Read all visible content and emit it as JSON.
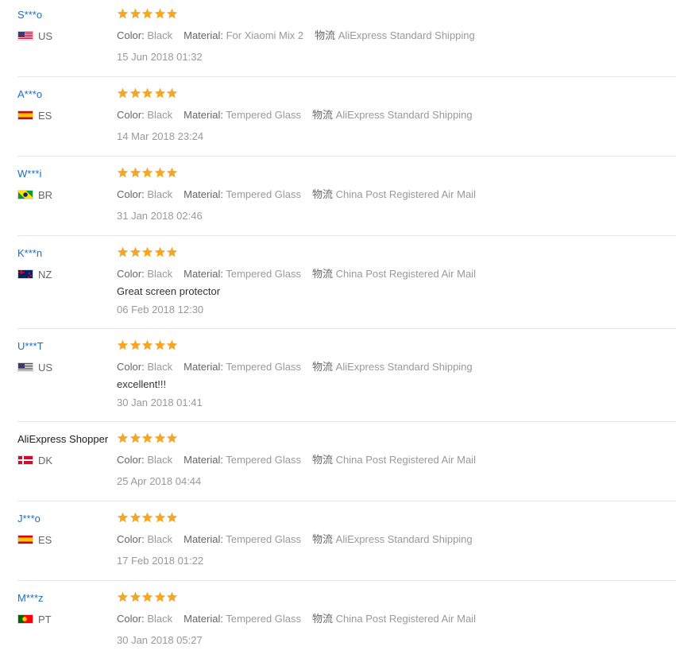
{
  "reviews": [
    {
      "user": "S***o",
      "country": "US",
      "flag": "us-flag-icon",
      "rating": 5,
      "color_label": "Color:",
      "color": "Black",
      "material_label": "Material:",
      "material": "For Xiaomi Mix 2",
      "shipping_label": "物流",
      "shipping": "AliExpress Standard Shipping",
      "feedback": "",
      "date": "15 Jun 2018 01:32"
    },
    {
      "user": "A***o",
      "country": "ES",
      "flag": "es-flag-icon",
      "rating": 5,
      "color_label": "Color:",
      "color": "Black",
      "material_label": "Material:",
      "material": "Tempered Glass",
      "shipping_label": "物流",
      "shipping": "AliExpress Standard Shipping",
      "feedback": "",
      "date": "14 Mar 2018 23:24"
    },
    {
      "user": "W***i",
      "country": "BR",
      "flag": "br-flag-icon",
      "rating": 5,
      "color_label": "Color:",
      "color": "Black",
      "material_label": "Material:",
      "material": "Tempered Glass",
      "shipping_label": "物流",
      "shipping": "China Post Registered Air Mail",
      "feedback": "",
      "date": "31 Jan 2018 02:46"
    },
    {
      "user": "K***n",
      "country": "NZ",
      "flag": "nz-flag-icon",
      "rating": 5,
      "color_label": "Color:",
      "color": "Black",
      "material_label": "Material:",
      "material": "Tempered Glass",
      "shipping_label": "物流",
      "shipping": "China Post Registered Air Mail",
      "feedback": "Great screen protector",
      "date": "06 Feb 2018 12:30"
    },
    {
      "user": "U***T",
      "country": "US",
      "flag": "us-flag-icon",
      "rating": 5,
      "color_label": "Color:",
      "color": "Black",
      "material_label": "Material:",
      "material": "Tempered Glass",
      "shipping_label": "物流",
      "shipping": "AliExpress Standard Shipping",
      "feedback": "excellent!!!",
      "date": "30 Jan 2018 01:41"
    },
    {
      "user": "AliExpress Shopper",
      "country": "DK",
      "flag": "dk-flag-icon",
      "rating": 5,
      "color_label": "Color:",
      "color": "Black",
      "material_label": "Material:",
      "material": "Tempered Glass",
      "shipping_label": "物流",
      "shipping": "China Post Registered Air Mail",
      "feedback": "",
      "date": "25 Apr 2018 04:44"
    },
    {
      "user": "J***o",
      "country": "ES",
      "flag": "es-flag-icon",
      "rating": 5,
      "color_label": "Color:",
      "color": "Black",
      "material_label": "Material:",
      "material": "Tempered Glass",
      "shipping_label": "物流",
      "shipping": "AliExpress Standard Shipping",
      "feedback": "",
      "date": "17 Feb 2018 01:22"
    },
    {
      "user": "M***z",
      "country": "PT",
      "flag": "pt-flag-icon",
      "rating": 5,
      "color_label": "Color:",
      "color": "Black",
      "material_label": "Material:",
      "material": "Tempered Glass",
      "shipping_label": "物流",
      "shipping": "China Post Registered Air Mail",
      "feedback": "",
      "date": "30 Jan 2018 05:27"
    }
  ],
  "colors": {
    "star": "#f5a623",
    "username_link": "#1a6fc2",
    "divider": "#e6e6e6"
  }
}
